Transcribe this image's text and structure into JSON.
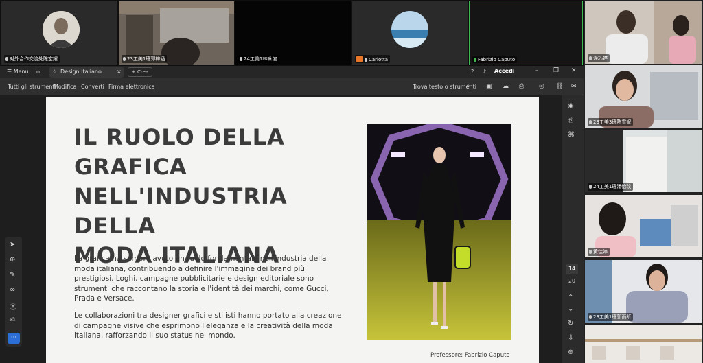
{
  "video_strip": {
    "tiles": [
      {
        "label": "对外合作交流处陈宏耀"
      },
      {
        "label": "23工美1班郭梓涵"
      },
      {
        "label": "24工美1林咏渲"
      },
      {
        "label": "Cariotta"
      },
      {
        "label": "Fabrizio Caputo"
      }
    ]
  },
  "right_column": {
    "tiles": [
      {
        "label": "涂巧婷"
      },
      {
        "label": "23工美3班陈雪妮"
      },
      {
        "label": "24工美1班潘怡玟"
      },
      {
        "label": "黄佳婷"
      },
      {
        "label": "23工美1班郭雨昕"
      },
      {
        "label": ""
      }
    ]
  },
  "acrobat": {
    "titlebar": {
      "menu_label": "Menu",
      "tab_title": "Design Italiano",
      "new_tab_label": "Crea",
      "signin_label": "Accedi"
    },
    "menubar": {
      "items": [
        "Tutti gli strumenti",
        "Modifica",
        "Converti",
        "Firma elettronica"
      ],
      "search_label": "Trova testo o strumenti"
    },
    "page_nav": {
      "current_page": "14",
      "total_pages": "20"
    },
    "tool_more_label": "···"
  },
  "slide": {
    "title_lines": [
      "IL RUOLO DELLA",
      "GRAFICA",
      "NELL'INDUSTRIA DELLA",
      "MODA ITALIANA"
    ],
    "paragraph1": "La grafica ha sempre avuto un ruolo fondamentale nell'industria della moda italiana, contribuendo a definire l'immagine dei brand più prestigiosi. Loghi, campagne pubblicitarie e design editoriale sono strumenti che raccontano la storia e l'identità dei marchi, come Gucci, Prada e Versace.",
    "paragraph2": "Le collaborazioni tra designer grafici e stilisti hanno portato alla creazione di campagne visive che esprimono l'eleganza e la creatività della moda italiana, rafforzando il suo status nel mondo.",
    "footer": "Professore: Fabrizio Caputo"
  },
  "colors": {
    "accent_blue": "#2b6fd6",
    "host_orange": "#e8772a",
    "active_speaker_green": "#3fb950",
    "title_text": "#3b3b3b"
  }
}
